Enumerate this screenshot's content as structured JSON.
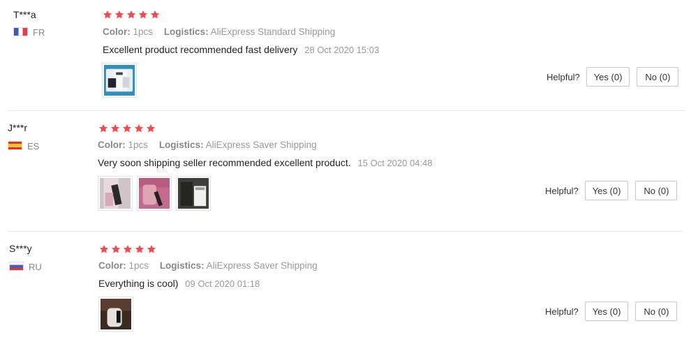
{
  "colors": {
    "star": "#f5484d",
    "divider": "#e8e8e8"
  },
  "reviews": [
    {
      "user": "T***a",
      "country": "FR",
      "flag": "france-flag",
      "rating": 5,
      "color_label": "Color:",
      "color_value": "1pcs",
      "logistics_label": "Logistics:",
      "logistics_value": "AliExpress Standard Shipping",
      "text": "Excellent product recommended fast delivery",
      "date": "28 Oct 2020 15:03",
      "photos": [
        "product-photo"
      ],
      "helpful_label": "Helpful?",
      "yes_label": "Yes (0)",
      "no_label": "No (0)"
    },
    {
      "user": "J***r",
      "country": "ES",
      "flag": "spain-flag",
      "rating": 5,
      "color_label": "Color:",
      "color_value": "1pcs",
      "logistics_label": "Logistics:",
      "logistics_value": "AliExpress Saver Shipping",
      "text": "Very soon shipping seller recommended excellent product.",
      "date": "15 Oct 2020 04:48",
      "photos": [
        "product-photo",
        "product-photo",
        "product-photo"
      ],
      "helpful_label": "Helpful?",
      "yes_label": "Yes (0)",
      "no_label": "No (0)"
    },
    {
      "user": "S***y",
      "country": "RU",
      "flag": "russia-flag",
      "rating": 5,
      "color_label": "Color:",
      "color_value": "1pcs",
      "logistics_label": "Logistics:",
      "logistics_value": "AliExpress Saver Shipping",
      "text": "Everything is cool)",
      "date": "09 Oct 2020 01:18",
      "photos": [
        "product-photo"
      ],
      "helpful_label": "Helpful?",
      "yes_label": "Yes (0)",
      "no_label": "No (0)"
    }
  ]
}
